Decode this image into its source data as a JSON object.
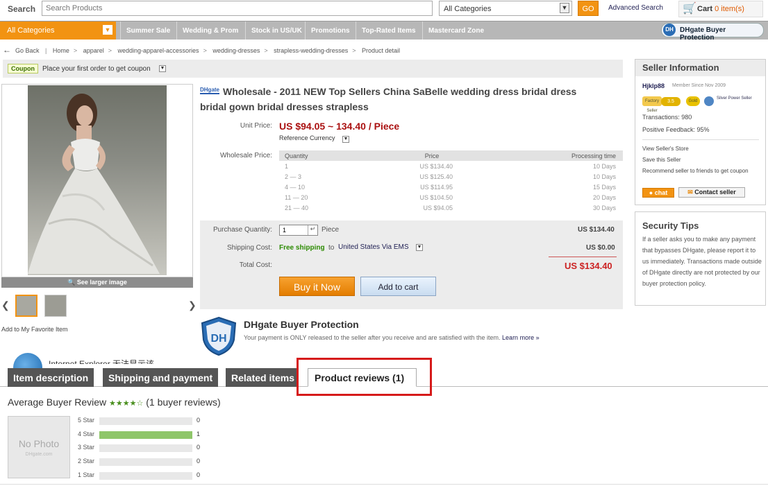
{
  "topbar": {
    "search_label": "Search",
    "search_placeholder": "Search Products",
    "category_value": "All Categories",
    "go_label": "GO",
    "advanced_search": "Advanced Search",
    "cart_label": "Cart",
    "cart_count": "0 item(s)"
  },
  "nav": {
    "all_categories": "All Categories",
    "tabs": [
      "Summer Sale",
      "Wedding & Prom",
      "Stock in US/UK",
      "Promotions",
      "Top-Rated Items",
      "Mastercard Zone"
    ],
    "buyer_protection": "DHgate Buyer Protection",
    "bp_icon": "DH"
  },
  "breadcrumb": {
    "go_back": "Go Back",
    "items": [
      "Home",
      "apparel",
      "wedding-apparel-accessories",
      "wedding-dresses",
      "strapless-wedding-dresses",
      "Product detail"
    ]
  },
  "coupon": {
    "badge": "Coupon",
    "text": "Place your first order to get coupon"
  },
  "gallery": {
    "see_larger": "See larger image",
    "favorite": "Add to My Favorite Item"
  },
  "product": {
    "title": "Wholesale - 2011 NEW Top Sellers China SaBelle wedding dress bridal dress bridal gown bridal dresses strapless",
    "title_logo": "DHgate",
    "unit_price_label": "Unit Price:",
    "unit_price": "US $94.05 ~ 134.40 / Piece",
    "reference_currency": "Reference Currency",
    "wholesale_label": "Wholesale Price:",
    "wholesale_headers": [
      "Quantity",
      "Price",
      "Processing time"
    ],
    "wholesale_rows": [
      [
        "1",
        "US $134.40",
        "10 Days"
      ],
      [
        "2 — 3",
        "US $125.40",
        "10 Days"
      ],
      [
        "4 — 10",
        "US $114.95",
        "15 Days"
      ],
      [
        "11 — 20",
        "US $104.50",
        "20 Days"
      ],
      [
        "21 — 40",
        "US $94.05",
        "30 Days"
      ]
    ],
    "purchase_qty_label": "Purchase Quantity:",
    "qty_value": "1",
    "qty_unit": "Piece",
    "qty_total": "US $134.40",
    "shipping_label": "Shipping Cost:",
    "shipping_free": "Free shipping",
    "shipping_to": "to",
    "shipping_dest": "United States Via EMS",
    "shipping_total": "US $0.00",
    "total_label": "Total Cost:",
    "total": "US $134.40",
    "buy_now": "Buy it Now",
    "add_to_cart": "Add to cart"
  },
  "buyer_protection": {
    "title": "DHgate Buyer Protection",
    "text": "Your payment is ONLY released to the seller after you receive and are satisfied with the item.",
    "learn_more": "Learn more »",
    "shield_text": "DH"
  },
  "seller": {
    "header": "Seller Information",
    "name": "Hjklp88",
    "member_since": "Member Since Nov 2009",
    "badge_factory": "Factory Seller",
    "badge_rating": "3.5",
    "badge_gold": "Gold",
    "badge_power": "Silver Power Seller",
    "transactions": "Transactions: 980",
    "positive_feedback": "Positive Feedback: 95%",
    "view_store": "View Seller's Store",
    "save_seller": "Save this Seller",
    "recommend": "Recommend seller to friends to get coupon",
    "chat": "chat",
    "contact": "Contact seller"
  },
  "security": {
    "header": "Security Tips",
    "text": "If a seller asks you to make any payment that bypasses DHgate, please report it to us immediately. Transactions made outside of DHgate directly are not protected by our buyer protection policy."
  },
  "partial_row": {
    "text": "Internet Explorer 无法显示该"
  },
  "tabs": {
    "item_description": "Item description",
    "shipping_payment": "Shipping and payment",
    "related_items": "Related items",
    "product_reviews": "Product reviews (1)"
  },
  "reviews": {
    "avg_title": "Average Buyer Review",
    "stars": "★★★★☆",
    "rating": 4,
    "count_text": "(1 buyer reviews)",
    "no_photo": "No Photo",
    "no_photo_sub": "DHgate.com",
    "breakdown": [
      {
        "label": "5 Star",
        "count": "0",
        "fraction": 0
      },
      {
        "label": "4 Star",
        "count": "1",
        "fraction": 1
      },
      {
        "label": "3 Star",
        "count": "0",
        "fraction": 0
      },
      {
        "label": "2 Star",
        "count": "0",
        "fraction": 0
      },
      {
        "label": "1 Star",
        "count": "0",
        "fraction": 0
      }
    ]
  },
  "colors": {
    "accent_orange": "#f29312",
    "price_red": "#aa1111",
    "highlight_red": "#d61a1a"
  }
}
